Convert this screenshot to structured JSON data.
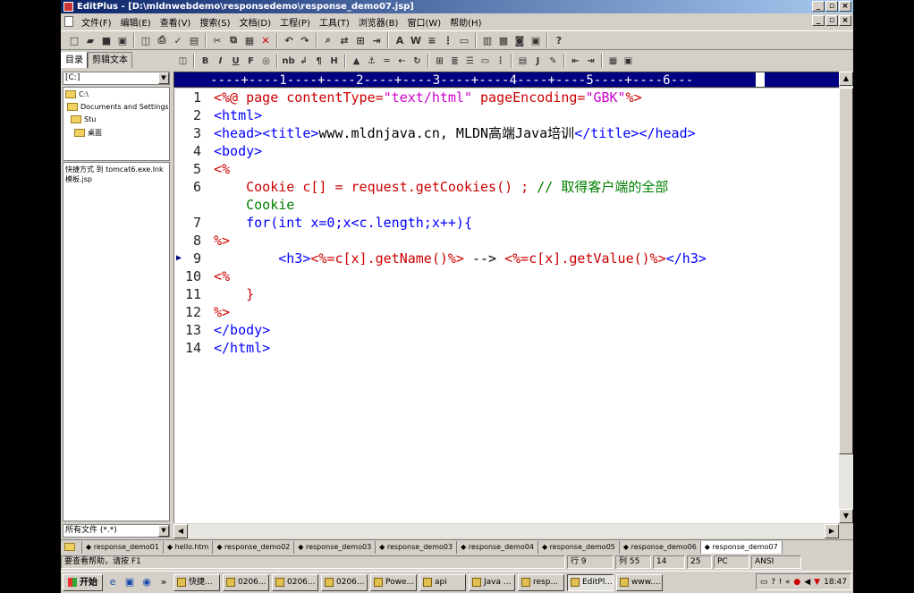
{
  "window": {
    "title": "EditPlus - [D:\\mldnwebdemo\\responsedemo\\response_demo07.jsp]"
  },
  "menu": [
    "文件(F)",
    "编辑(E)",
    "查看(V)",
    "搜索(S)",
    "文档(D)",
    "工程(P)",
    "工具(T)",
    "浏览器(B)",
    "窗口(W)",
    "帮助(H)"
  ],
  "sidebar": {
    "tabs": [
      "目录",
      "剪辑文本"
    ],
    "drive": "[C:]",
    "tree": [
      "C:\\",
      "Documents and Settings",
      "Stu",
      "桌面"
    ],
    "files": [
      "快捷方式 到 tomcat6.exe.lnk",
      "模板.jsp"
    ],
    "filter": "所有文件 (*.*)"
  },
  "ruler": {
    "text": "----+----1----+----2----+----3----+----4----+----5----+----6---"
  },
  "editor": {
    "lines": [
      {
        "n": "1",
        "segs": [
          [
            "<%@ ",
            "t-red"
          ],
          [
            "page ",
            "t-red"
          ],
          [
            "contentType=",
            "t-red"
          ],
          [
            "\"text/html\"",
            "t-mag"
          ],
          [
            " pageEncoding=",
            "t-red"
          ],
          [
            "\"GBK\"",
            "t-mag"
          ],
          [
            "%>",
            "t-red"
          ]
        ]
      },
      {
        "n": "2",
        "segs": [
          [
            "<html>",
            "t-blue"
          ]
        ]
      },
      {
        "n": "3",
        "segs": [
          [
            "<head>",
            "t-blue"
          ],
          [
            "<title>",
            "t-blue"
          ],
          [
            "www.mldnjava.cn, MLDN高端Java培训",
            "t-black"
          ],
          [
            "</title>",
            "t-blue"
          ],
          [
            "</head>",
            "t-blue"
          ]
        ]
      },
      {
        "n": "4",
        "segs": [
          [
            "<body>",
            "t-blue"
          ]
        ]
      },
      {
        "n": "5",
        "segs": [
          [
            "<%",
            "t-red"
          ]
        ]
      },
      {
        "n": "6",
        "segs": [
          [
            "    Cookie c[] = request.getCookies() ; ",
            "t-red"
          ],
          [
            "// 取得客户端的全部",
            "t-green"
          ]
        ]
      },
      {
        "n": "",
        "segs": [
          [
            "    Cookie",
            "t-green"
          ]
        ]
      },
      {
        "n": "7",
        "segs": [
          [
            "    for(int x=0;x<c.length;x++){",
            "t-blue"
          ]
        ]
      },
      {
        "n": "8",
        "segs": [
          [
            "%>",
            "t-red"
          ]
        ]
      },
      {
        "n": "9",
        "segs": [
          [
            "        <h3>",
            "t-blue"
          ],
          [
            "<%=c[x].getName()%>",
            "t-red"
          ],
          [
            " --> ",
            "t-black"
          ],
          [
            "<%=c[x].getValue()%>",
            "t-red"
          ],
          [
            "</h3>",
            "t-blue"
          ]
        ]
      },
      {
        "n": "10",
        "segs": [
          [
            "<%",
            "t-red"
          ]
        ]
      },
      {
        "n": "11",
        "segs": [
          [
            "    }",
            "t-red"
          ]
        ]
      },
      {
        "n": "12",
        "segs": [
          [
            "%>",
            "t-red"
          ]
        ]
      },
      {
        "n": "13",
        "segs": [
          [
            "</body>",
            "t-blue"
          ]
        ]
      },
      {
        "n": "14",
        "segs": [
          [
            "</html>",
            "t-blue"
          ]
        ]
      }
    ]
  },
  "doctabs": [
    "response_demo01",
    "hello.htm",
    "response_demo02",
    "response_demo03",
    "response_demo03",
    "response_demo04",
    "response_demo05",
    "response_demo06",
    "response_demo07"
  ],
  "status": {
    "help": "要查看帮助，请按 F1",
    "row": "行 9",
    "col": "列 55",
    "total": "14",
    "size": "25",
    "mode": "PC",
    "encoding": "ANSI"
  },
  "taskbar": {
    "start": "开始",
    "tasks": [
      "快捷...",
      "0206...",
      "0206...",
      "0206...",
      "Powe...",
      "api",
      "Java ...",
      "resp...",
      "EditPl...",
      "www...."
    ],
    "clock": "18:47"
  }
}
